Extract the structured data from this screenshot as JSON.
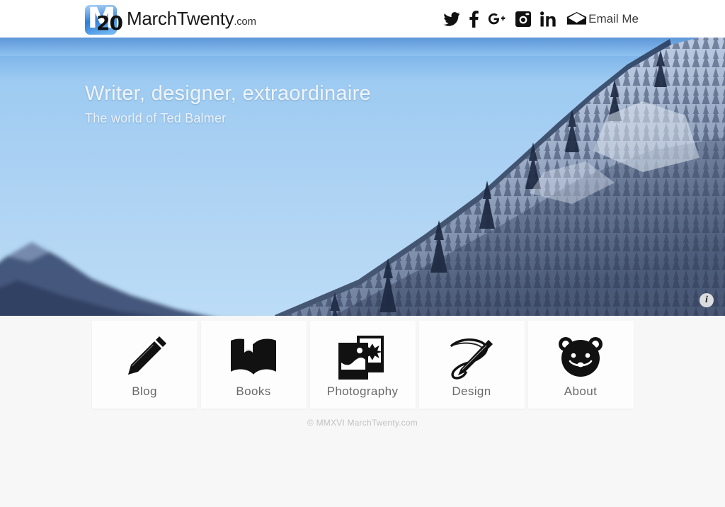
{
  "site": {
    "background_color": "#f7f7f7",
    "brand": {
      "logo_initial": "M",
      "logo_number": "20",
      "name_part1": "March",
      "name_part2": "Twenty",
      "name_suffix": ".com",
      "logo_color": "#2f7fd8"
    }
  },
  "header": {
    "social": [
      {
        "name": "twitter-icon",
        "label": "Twitter"
      },
      {
        "name": "facebook-icon",
        "label": "Facebook"
      },
      {
        "name": "googleplus-icon",
        "label": "Google Plus"
      },
      {
        "name": "instagram-icon",
        "label": "Instagram"
      },
      {
        "name": "linkedin-icon",
        "label": "LinkedIn"
      }
    ],
    "email": {
      "icon": "envelope-icon",
      "text": "Email  Me"
    }
  },
  "hero": {
    "headline": "Writer, designer, extraordinaire",
    "subhead": "The world of Ted Balmer",
    "info_badge": "i",
    "image_description": "snow-covered forested mountain ridge against blue sky",
    "sky_color": "#a8cdf0",
    "mountain_color": "#3c4f72"
  },
  "nav": {
    "cards": [
      {
        "icon": "pencil-icon",
        "label": "Blog"
      },
      {
        "icon": "open-book-icon",
        "label": "Books"
      },
      {
        "icon": "photos-icon",
        "label": "Photography"
      },
      {
        "icon": "fountain-pen-icon",
        "label": "Design"
      },
      {
        "icon": "bear-face-icon",
        "label": "About"
      }
    ]
  },
  "footer": {
    "copyright": "© MMXVI MarchTwenty.com"
  }
}
